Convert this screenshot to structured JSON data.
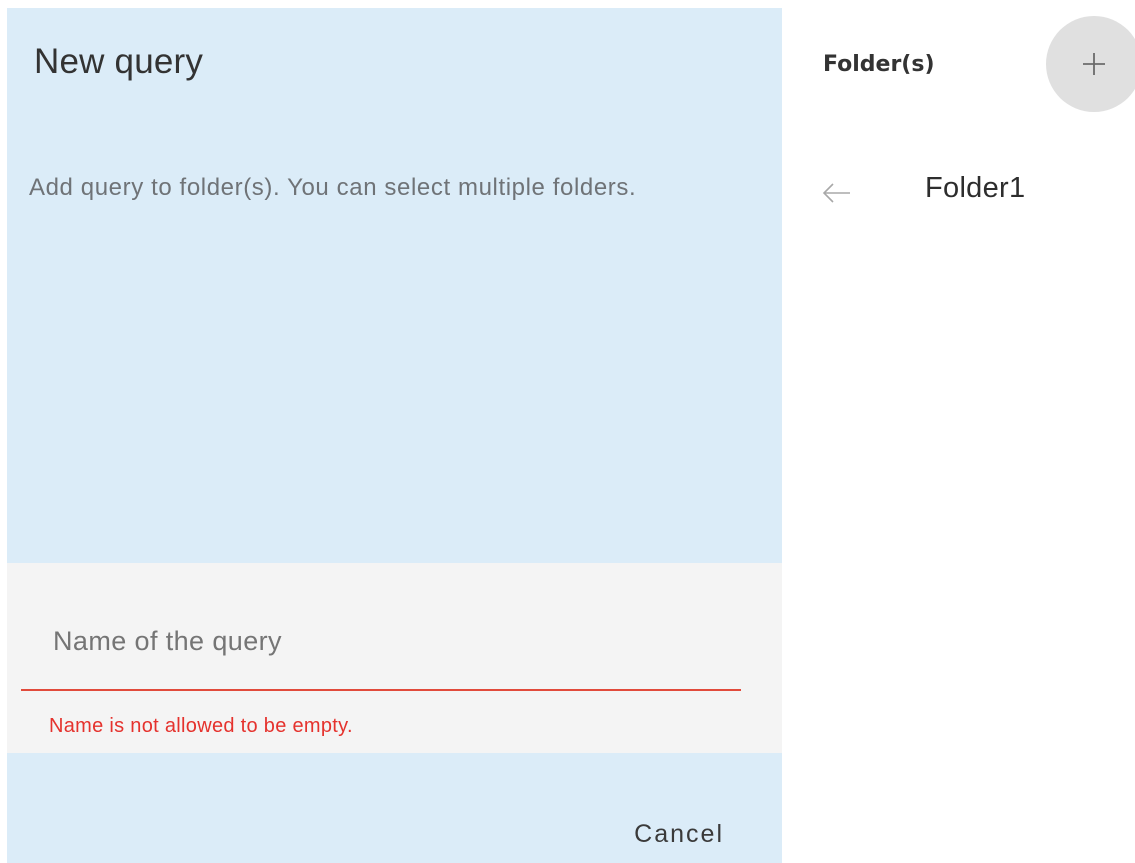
{
  "dialog": {
    "title": "New query",
    "description": "Add query to folder(s). You can select multiple folders.",
    "name_field": {
      "placeholder": "Name of the query",
      "value": "",
      "error": "Name is not allowed to be empty."
    },
    "cancel_label": "Cancel"
  },
  "folders": {
    "header": "Folder(s)",
    "add_icon": "plus-icon",
    "back_icon": "arrow-left-icon",
    "items": [
      {
        "name": "Folder1"
      }
    ]
  },
  "colors": {
    "panel_background": "#dbecf8",
    "field_background": "#f4f4f4",
    "error": "#e5322d",
    "add_button_background": "#e0e0e0"
  }
}
